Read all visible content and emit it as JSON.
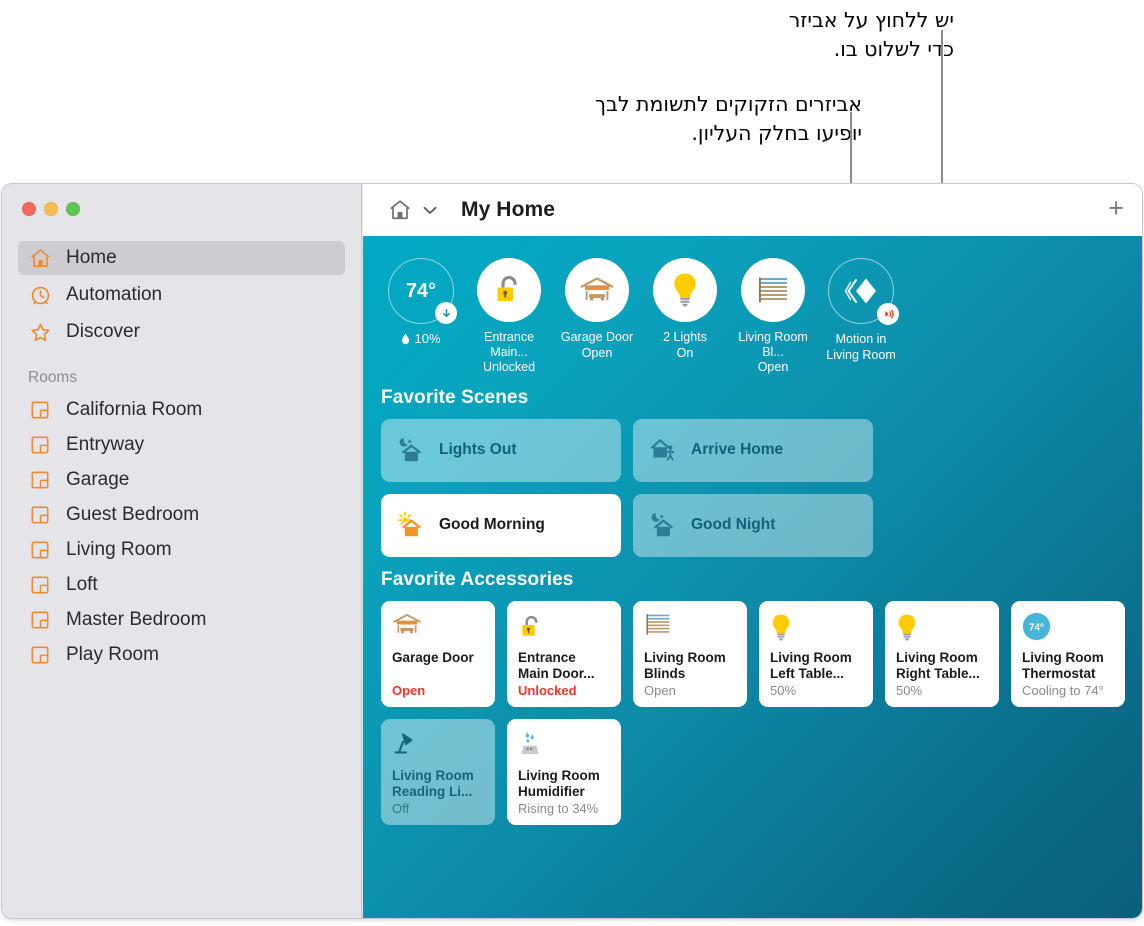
{
  "callouts": [
    {
      "id": "c1",
      "text": "יש ללחוץ על אביזר\nכדי לשלוט בו."
    },
    {
      "id": "c2",
      "text": "אביזרים הזקוקים לתשומת לבך\nיופיעו בחלק העליון."
    }
  ],
  "window": {
    "traffic": {
      "close": "close-button",
      "minimize": "minimize-button",
      "zoom": "zoom-button"
    }
  },
  "sidebar": {
    "nav": [
      {
        "label": "Home",
        "icon": "house-icon",
        "active": true
      },
      {
        "label": "Automation",
        "icon": "clock-icon",
        "active": false
      },
      {
        "label": "Discover",
        "icon": "star-icon",
        "active": false
      }
    ],
    "rooms_label": "Rooms",
    "rooms": [
      {
        "label": "California Room",
        "icon": "room-icon"
      },
      {
        "label": "Entryway",
        "icon": "room-icon"
      },
      {
        "label": "Garage",
        "icon": "room-icon"
      },
      {
        "label": "Guest Bedroom",
        "icon": "room-icon"
      },
      {
        "label": "Living Room",
        "icon": "room-icon"
      },
      {
        "label": "Loft",
        "icon": "room-icon"
      },
      {
        "label": "Master Bedroom",
        "icon": "room-icon"
      },
      {
        "label": "Play Room",
        "icon": "room-icon"
      }
    ]
  },
  "titlebar": {
    "home_icon": "house-icon",
    "chevron": "chevron-down-icon",
    "title": "My Home",
    "add": "+"
  },
  "status": [
    {
      "kind": "climate",
      "temperature": "74°",
      "humidity": "10%",
      "humidity_icon": "water-drop-icon",
      "badge": "arrow-down-icon"
    },
    {
      "kind": "lock",
      "icon": "unlocked-padlock-icon",
      "name": "Entrance Main...",
      "state": "Unlocked"
    },
    {
      "kind": "garage",
      "icon": "garage-door-icon",
      "name": "Garage Door",
      "state": "Open"
    },
    {
      "kind": "light",
      "icon": "lightbulb-icon",
      "name": "2 Lights",
      "state": "On"
    },
    {
      "kind": "blinds",
      "icon": "window-blinds-icon",
      "name": "Living Room Bl...",
      "state": "Open"
    },
    {
      "kind": "motion",
      "icon": "motion-sensor-icon",
      "badge": "motion-waves-icon",
      "name": "Motion in",
      "state": "Living Room"
    }
  ],
  "scenes_heading": "Favorite Scenes",
  "scenes": [
    {
      "label": "Lights Out",
      "icon": "moon-house-icon",
      "on": false
    },
    {
      "label": "Arrive Home",
      "icon": "house-person-icon",
      "on": false
    },
    {
      "label": "Good Morning",
      "icon": "sun-house-icon",
      "on": true
    },
    {
      "label": "Good Night",
      "icon": "moon-house-icon",
      "on": false
    }
  ],
  "accessories_heading": "Favorite Accessories",
  "accessories": [
    {
      "name": "Garage Door",
      "state": "Open",
      "icon": "garage-door-icon",
      "on": true,
      "alert": true
    },
    {
      "name": "Entrance Main Door...",
      "state": "Unlocked",
      "icon": "unlocked-padlock-icon",
      "on": true,
      "alert": true
    },
    {
      "name": "Living Room Blinds",
      "state": "Open",
      "icon": "window-blinds-icon",
      "on": true,
      "alert": false
    },
    {
      "name": "Living Room Left Table...",
      "state": "50%",
      "icon": "lightbulb-icon",
      "on": true,
      "alert": false
    },
    {
      "name": "Living Room Right Table...",
      "state": "50%",
      "icon": "lightbulb-icon",
      "on": true,
      "alert": false
    },
    {
      "name": "Living Room Thermostat",
      "state": "Cooling to 74°",
      "icon": "thermostat-icon",
      "on": true,
      "alert": false,
      "temp": "74°"
    },
    {
      "name": "Living Room Reading Li...",
      "state": "Off",
      "icon": "desk-lamp-icon",
      "on": false,
      "alert": false
    },
    {
      "name": "Living Room Humidifier",
      "state": "Rising to 34%",
      "icon": "humidifier-icon",
      "on": true,
      "alert": false
    }
  ],
  "colors": {
    "accent_orange": "#EE8A31",
    "alert_red": "#F6352B",
    "scene_text": "#12607A",
    "bg_top": "#00A9C4",
    "bg_bottom": "#095F7C",
    "bulb_yellow": "#FFCC00",
    "thermo_blue": "#45B6D6"
  }
}
